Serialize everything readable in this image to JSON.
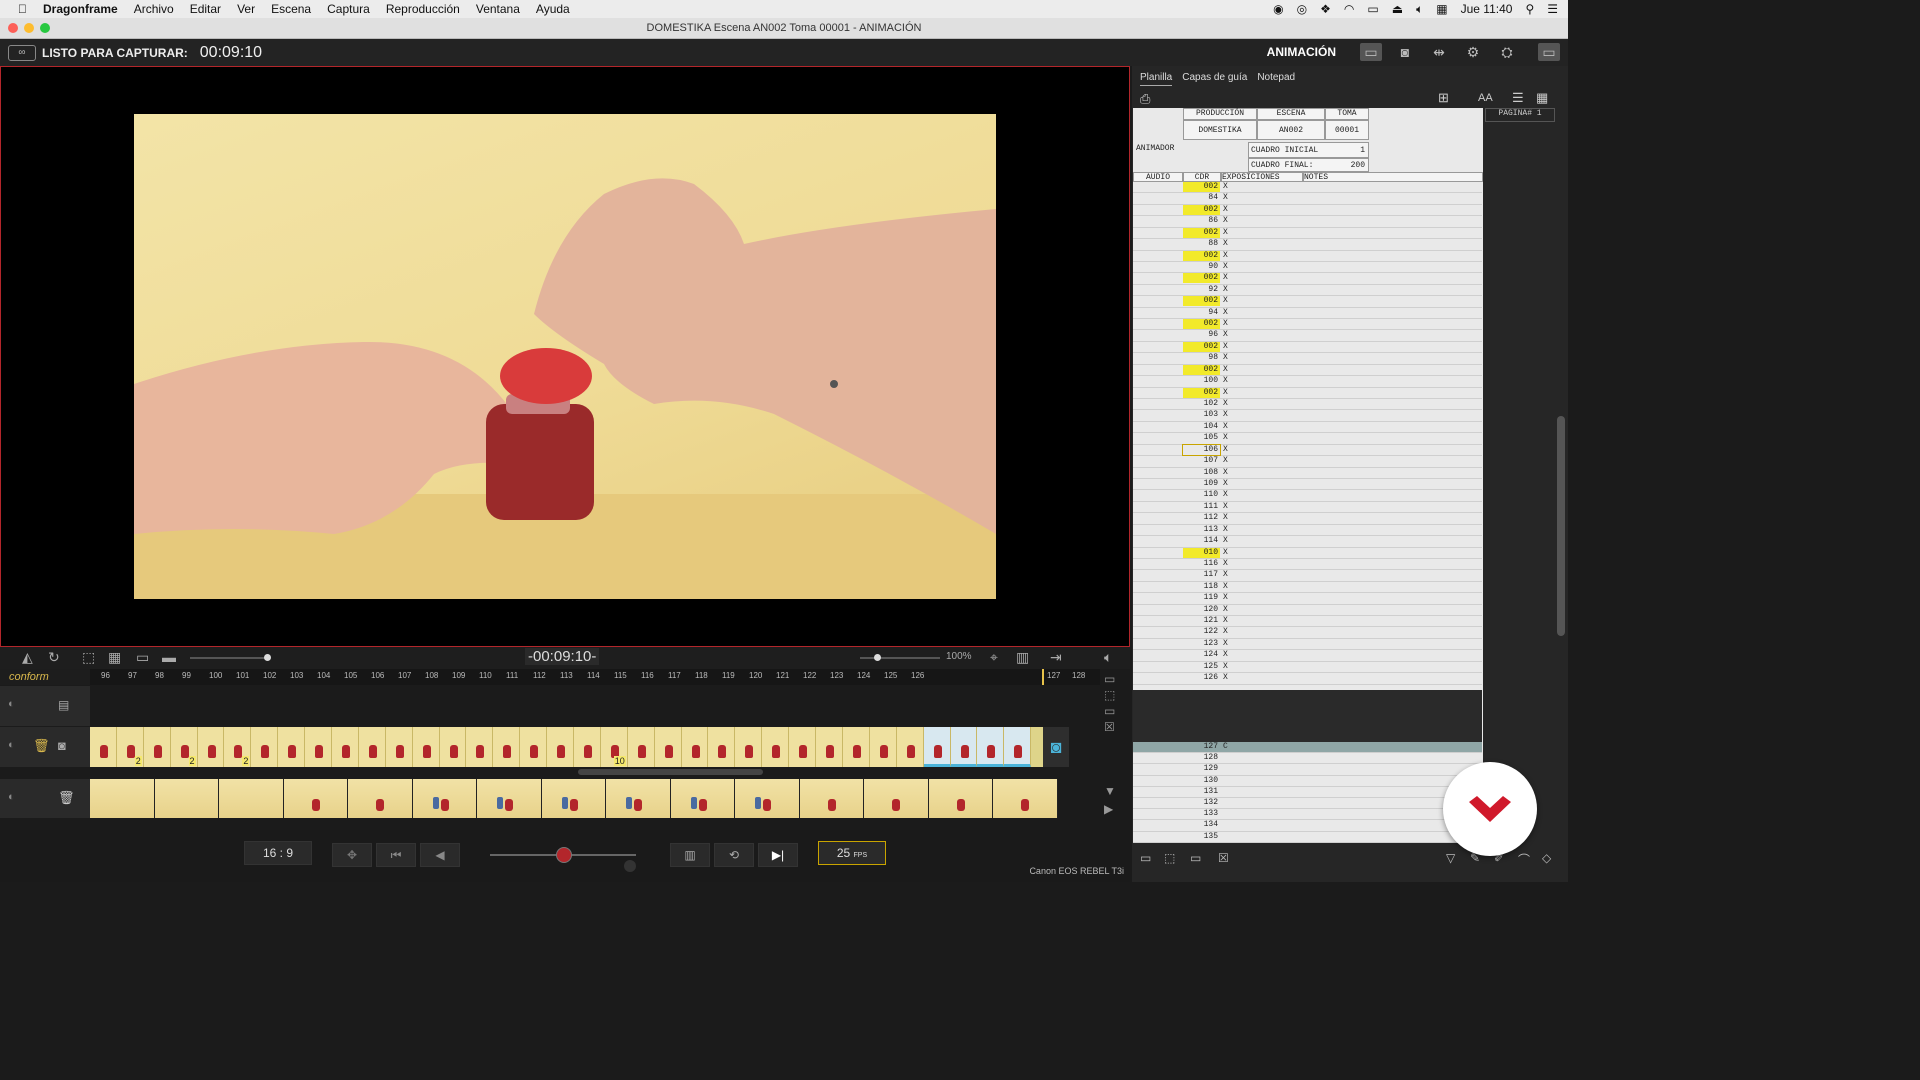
{
  "menubar": {
    "apple": "",
    "items": [
      "Dragonframe",
      "Archivo",
      "Editar",
      "Ver",
      "Escena",
      "Captura",
      "Reproducción",
      "Ventana",
      "Ayuda"
    ],
    "clock": "Jue 11:40"
  },
  "window": {
    "title": "DOMESTIKA  Escena AN002  Toma 00001 - ANIMACIÓN"
  },
  "topbar": {
    "status_label": "LISTO PARA CAPTURAR:",
    "timecode": "00:09:10",
    "mode": "ANIMACIÓN"
  },
  "viewer": {
    "timecode": "-00:09:10-",
    "zoom": "100%"
  },
  "timeline": {
    "track_name": "conform",
    "ruler": [
      "96",
      "97",
      "98",
      "99",
      "100",
      "101",
      "102",
      "103",
      "104",
      "105",
      "106",
      "107",
      "108",
      "109",
      "110",
      "111",
      "112",
      "113",
      "114",
      "115",
      "116",
      "117",
      "118",
      "119",
      "120",
      "121",
      "122",
      "123",
      "124",
      "125",
      "126",
      "127",
      "128"
    ],
    "hold_labels": [
      "2",
      "2",
      "2",
      "10"
    ]
  },
  "bottom": {
    "aspect": "16 : 9",
    "fps": "25",
    "fps_unit": "FPS",
    "camera": "Canon EOS REBEL T3i"
  },
  "panel": {
    "tabs": [
      "Planilla",
      "Capas de guía",
      "Notepad"
    ],
    "font_btn": "AA",
    "header": {
      "produccion_label": "PRODUCCIÓN",
      "escena_label": "ESCENA",
      "toma_label": "TOMA",
      "produccion": "DOMESTIKA",
      "escena": "AN002",
      "toma": "00001",
      "pagina": "PAGINA# 1",
      "animador": "ANIMADOR",
      "cuadro_inicial_label": "CUADRO INICIAL",
      "cuadro_inicial": "1",
      "cuadro_final_label": "CUADRO FINAL:",
      "cuadro_final": "200",
      "col_audio": "AUDIO",
      "col_cdr": "CDR",
      "col_exp": "EXPOSICIONES",
      "col_notes": "NOTES"
    },
    "rows": [
      {
        "c": "002",
        "y": true
      },
      {
        "c": "84"
      },
      {
        "c": "002",
        "y": true
      },
      {
        "c": "86"
      },
      {
        "c": "002",
        "y": true
      },
      {
        "c": "88"
      },
      {
        "c": "002",
        "y": true
      },
      {
        "c": "90"
      },
      {
        "c": "002",
        "y": true
      },
      {
        "c": "92"
      },
      {
        "c": "002",
        "y": true
      },
      {
        "c": "94"
      },
      {
        "c": "002",
        "y": true
      },
      {
        "c": "96"
      },
      {
        "c": "002",
        "y": true
      },
      {
        "c": "98"
      },
      {
        "c": "002",
        "y": true
      },
      {
        "c": "100"
      },
      {
        "c": "002",
        "y": true
      },
      {
        "c": "102"
      },
      {
        "c": "103"
      },
      {
        "c": "104"
      },
      {
        "c": "105"
      },
      {
        "c": "106",
        "o": true
      },
      {
        "c": "107"
      },
      {
        "c": "108"
      },
      {
        "c": "109"
      },
      {
        "c": "110"
      },
      {
        "c": "111"
      },
      {
        "c": "112"
      },
      {
        "c": "113"
      },
      {
        "c": "114"
      },
      {
        "c": "010",
        "y": true
      },
      {
        "c": "116"
      },
      {
        "c": "117"
      },
      {
        "c": "118"
      },
      {
        "c": "119"
      },
      {
        "c": "120"
      },
      {
        "c": "121"
      },
      {
        "c": "122"
      },
      {
        "c": "123"
      },
      {
        "c": "124"
      },
      {
        "c": "125"
      },
      {
        "c": "126"
      }
    ],
    "tail_rows": [
      "127",
      "128",
      "129",
      "130",
      "131",
      "132",
      "133",
      "134",
      "135"
    ],
    "cur_mark": "C",
    "x_mark": "X"
  },
  "colors": {
    "accent": "#b3262b",
    "highlight": "#f2ea2a",
    "timeline_blue": "#4bb3d8"
  }
}
